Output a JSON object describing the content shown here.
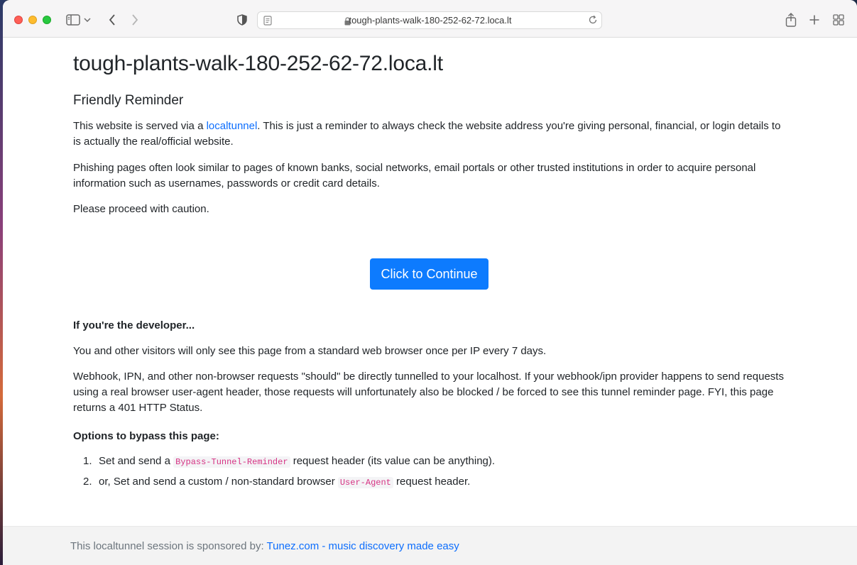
{
  "browser": {
    "url": "tough-plants-walk-180-252-62-72.loca.lt"
  },
  "page": {
    "title": "tough-plants-walk-180-252-62-72.loca.lt",
    "subtitle": "Friendly Reminder",
    "para1_pre": "This website is served via a ",
    "para1_link": "localtunnel",
    "para1_post": ". This is just a reminder to always check the website address you're giving personal, financial, or login details to is actually the real/official website.",
    "para2": "Phishing pages often look similar to pages of known banks, social networks, email portals or other trusted institutions in order to acquire personal information such as usernames, passwords or credit card details.",
    "para3": "Please proceed with caution.",
    "continue_button": "Click to Continue",
    "dev_heading": "If you're the developer...",
    "dev_para1": "You and other visitors will only see this page from a standard web browser once per IP every 7 days.",
    "dev_para2": "Webhook, IPN, and other non-browser requests \"should\" be directly tunnelled to your localhost. If your webhook/ipn provider happens to send requests using a real browser user-agent header, those requests will unfortunately also be blocked / be forced to see this tunnel reminder page. FYI, this page returns a 401 HTTP Status.",
    "options_heading": "Options to bypass this page:",
    "options": [
      {
        "num": "1.",
        "pre": "Set and send a ",
        "code": "Bypass-Tunnel-Reminder",
        "post": " request header (its value can be anything)."
      },
      {
        "num": "2.",
        "pre": "or, Set and send a custom / non-standard browser ",
        "code": "User-Agent",
        "post": " request header."
      }
    ]
  },
  "footer": {
    "text": "This localtunnel session is sponsored by: ",
    "link": "Tunez.com - music discovery made easy"
  },
  "colors": {
    "accent": "#0d7bfe",
    "link": "#0d6efd",
    "code": "#d63384"
  },
  "icons": [
    "sidebar-icon",
    "chevron-down-icon",
    "back-icon",
    "forward-icon",
    "shield-icon",
    "reader-icon",
    "lock-icon",
    "reload-icon",
    "share-icon",
    "new-tab-icon",
    "tab-overview-icon"
  ]
}
